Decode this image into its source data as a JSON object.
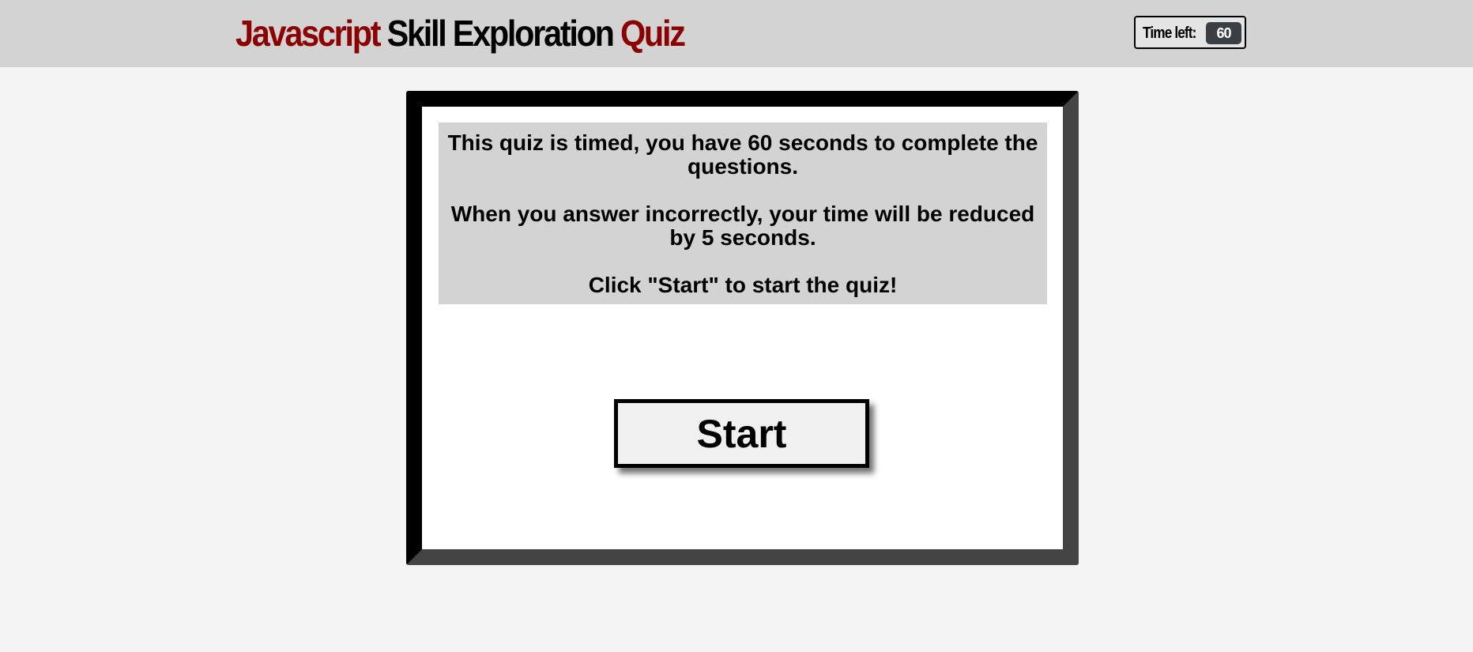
{
  "header": {
    "title_part1": "Javascript",
    "title_part2": "Skill Exploration",
    "title_part3": "Quiz",
    "timer_label": "Time left:",
    "timer_value": "60"
  },
  "instructions": {
    "line1": "This quiz is timed, you have 60 seconds to complete the questions.",
    "line2": "When you answer incorrectly, your time will be reduced by 5 seconds.",
    "line3": "Click \"Start\" to start the quiz!"
  },
  "start_button": {
    "label": "Start"
  },
  "colors": {
    "accent_red": "#8b0000",
    "header_bg": "#d3d3d3",
    "timer_badge": "#3a3f44"
  }
}
